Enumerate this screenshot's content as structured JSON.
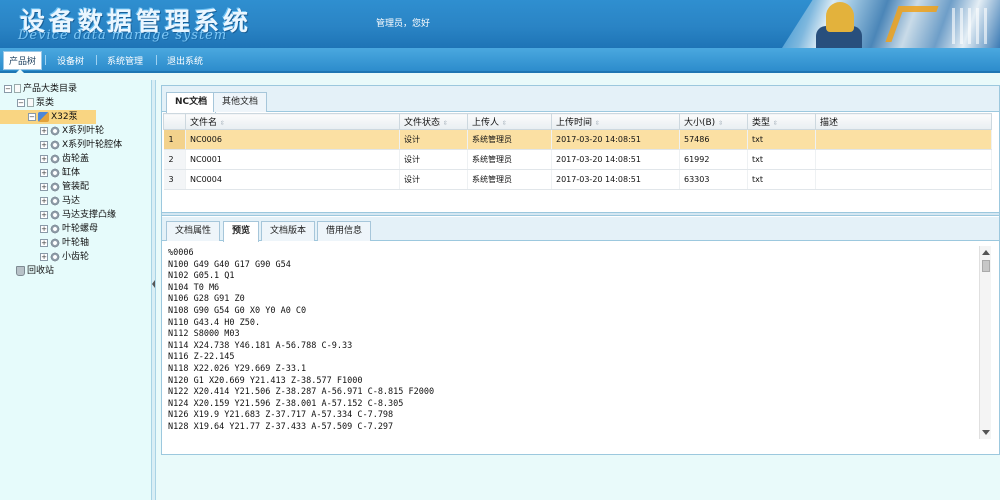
{
  "header": {
    "title": "设备数据管理系统",
    "subtitle": "Device data manage system",
    "user_greeting": "管理员，您好"
  },
  "nav": {
    "items": [
      {
        "label": "产品树",
        "active": true
      },
      {
        "label": "设备树",
        "active": false
      },
      {
        "label": "系统管理",
        "active": false
      },
      {
        "label": "退出系统",
        "active": false
      }
    ]
  },
  "tree": {
    "nodes": [
      {
        "label": "产品大类目录",
        "expander": "−",
        "icon": "doc-icon"
      },
      {
        "label": "泵类",
        "expander": "−",
        "icon": "doc-icon"
      },
      {
        "label": "X32泵",
        "expander": "−",
        "icon": "pump-icon",
        "selected": true
      },
      {
        "label": "X系列叶轮",
        "expander": "+",
        "icon": "gear-icon"
      },
      {
        "label": "X系列叶轮腔体",
        "expander": "+",
        "icon": "gear-icon"
      },
      {
        "label": "齿轮盖",
        "expander": "+",
        "icon": "gear-icon"
      },
      {
        "label": "缸体",
        "expander": "+",
        "icon": "gear-icon"
      },
      {
        "label": "管装配",
        "expander": "+",
        "icon": "gear-icon"
      },
      {
        "label": "马达",
        "expander": "+",
        "icon": "gear-icon"
      },
      {
        "label": "马达支撑凸缘",
        "expander": "+",
        "icon": "gear-icon"
      },
      {
        "label": "叶轮螺母",
        "expander": "+",
        "icon": "gear-icon"
      },
      {
        "label": "叶轮轴",
        "expander": "+",
        "icon": "gear-icon"
      },
      {
        "label": "小齿轮",
        "expander": "+",
        "icon": "gear-icon"
      },
      {
        "label": "回收站",
        "expander": "",
        "icon": "recycle-bin-icon"
      }
    ]
  },
  "doc_tabs": [
    {
      "label": "NC文档",
      "active": true
    },
    {
      "label": "其他文档",
      "active": false
    }
  ],
  "grid": {
    "columns": [
      "文件名",
      "文件状态",
      "上传人",
      "上传时间",
      "大小(B)",
      "类型",
      "描述"
    ],
    "rows": [
      {
        "num": "1",
        "cells": [
          "NC0006",
          "设计",
          "系统管理员",
          "2017-03-20 14:08:51",
          "57486",
          "txt",
          ""
        ],
        "selected": true
      },
      {
        "num": "2",
        "cells": [
          "NC0001",
          "设计",
          "系统管理员",
          "2017-03-20 14:08:51",
          "61992",
          "txt",
          ""
        ],
        "selected": false
      },
      {
        "num": "3",
        "cells": [
          "NC0004",
          "设计",
          "系统管理员",
          "2017-03-20 14:08:51",
          "63303",
          "txt",
          ""
        ],
        "selected": false
      }
    ]
  },
  "detail_tabs": [
    {
      "label": "文档属性",
      "active": false
    },
    {
      "label": "预览",
      "active": true
    },
    {
      "label": "文档版本",
      "active": false
    },
    {
      "label": "借用信息",
      "active": false
    }
  ],
  "preview": {
    "lines": [
      "%0006",
      "N100 G49 G40 G17 G90 G54",
      "N102 G05.1 Q1",
      "N104 T0 M6",
      "N106 G28 G91 Z0",
      "N108 G90 G54 G0 X0 Y0 A0 C0",
      "N110 G43.4 H0 Z50.",
      "N112 S8000 M03",
      "N114 X24.738 Y46.181 A-56.788 C-9.33",
      "N116 Z-22.145",
      "N118 X22.026 Y29.669 Z-33.1",
      "N120 G1 X20.669 Y21.413 Z-38.577 F1000",
      "N122 X20.414 Y21.506 Z-38.287 A-56.971 C-8.815 F2000",
      "N124 X20.159 Y21.596 Z-38.001 A-57.152 C-8.305",
      "N126 X19.9 Y21.683 Z-37.717 A-57.334 C-7.798",
      "N128 X19.64 Y21.77 Z-37.433 A-57.509 C-7.297"
    ]
  }
}
